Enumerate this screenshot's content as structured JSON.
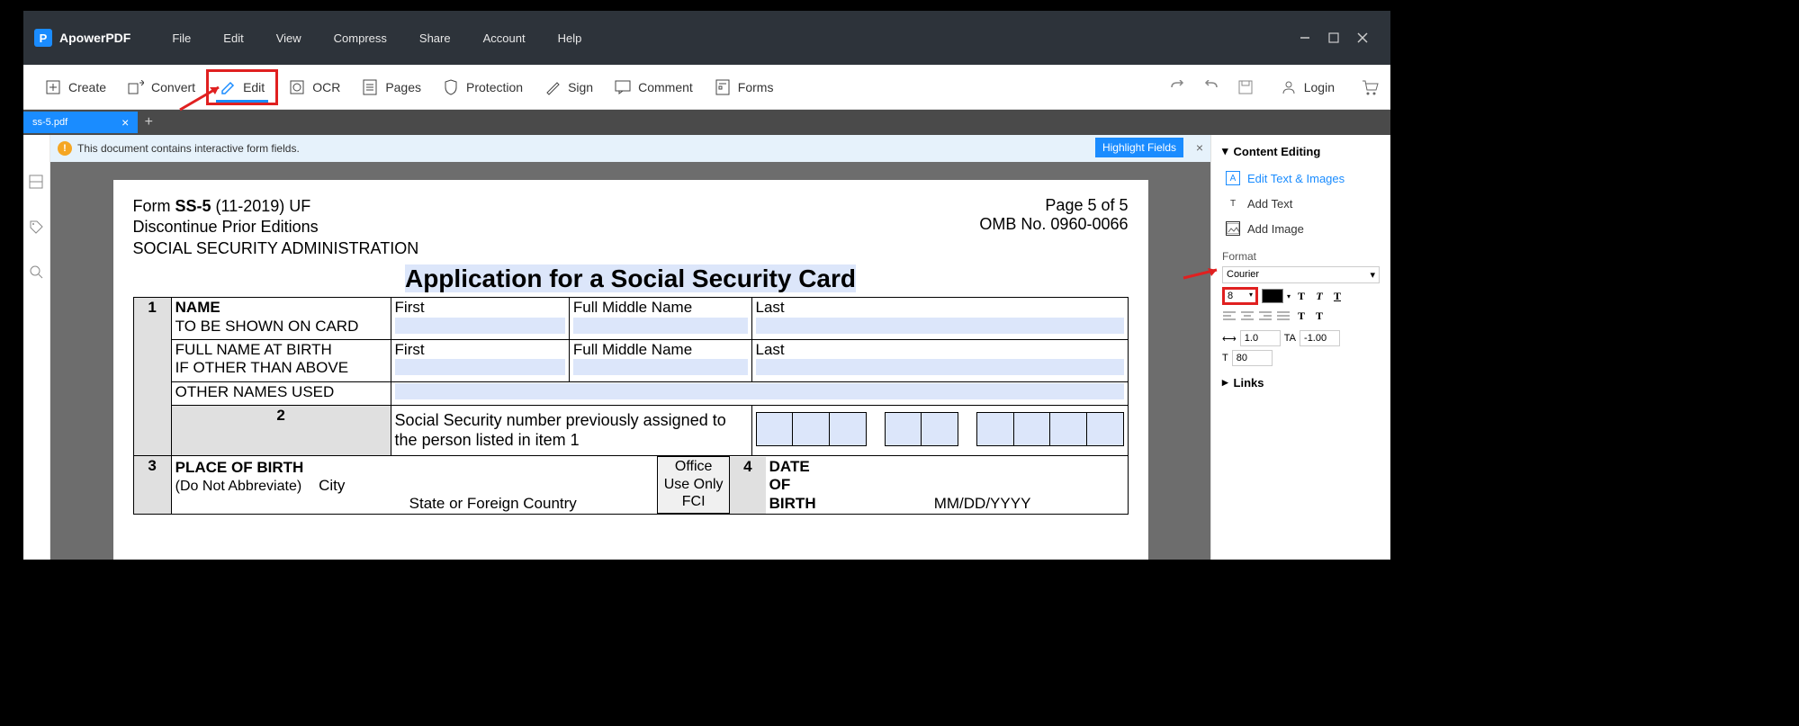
{
  "app": {
    "name": "ApowerPDF"
  },
  "menu": {
    "file": "File",
    "edit": "Edit",
    "view": "View",
    "compress": "Compress",
    "share": "Share",
    "account": "Account",
    "help": "Help"
  },
  "toolbar": {
    "create": "Create",
    "convert": "Convert",
    "edit": "Edit",
    "ocr": "OCR",
    "pages": "Pages",
    "protection": "Protection",
    "sign": "Sign",
    "comment": "Comment",
    "forms": "Forms",
    "login": "Login"
  },
  "tab": {
    "name": "ss-5.pdf"
  },
  "notice": {
    "text": "This document contains interactive form fields.",
    "highlight": "Highlight Fields"
  },
  "doc": {
    "form_id_pre": "Form ",
    "form_id_bold": "SS-5",
    "form_id_post": " (11-2019) UF",
    "discontinue": "Discontinue Prior Editions",
    "agency": "SOCIAL SECURITY ADMINISTRATION",
    "page_info": "Page 5 of 5",
    "omb": "OMB No. 0960-0066",
    "title": "Application for a Social Security Card",
    "name_label": "NAME",
    "name_sub": "TO BE SHOWN ON CARD",
    "full_name_label": "FULL NAME AT BIRTH",
    "if_other": "IF OTHER THAN ABOVE",
    "other_names": "OTHER NAMES USED",
    "first": "First",
    "middle": "Full Middle Name",
    "last": "Last",
    "ssn_text": "Social Security number previously assigned to the person listed in item 1",
    "pob_label": "PLACE OF BIRTH",
    "pob_sub": "(Do Not Abbreviate)",
    "city": "City",
    "state": "State or Foreign Country",
    "office": "Office Use Only",
    "fci": "FCI",
    "dob_label": "DATE OF BIRTH",
    "dob_fmt": "MM/DD/YYYY"
  },
  "panel": {
    "content_editing": "Content Editing",
    "edit_text": "Edit Text & Images",
    "add_text": "Add Text",
    "add_image": "Add Image",
    "format": "Format",
    "font": "Courier",
    "size": "8",
    "spacing1": "1.0",
    "spacing2": "-1.00",
    "spacing3": "80",
    "links": "Links"
  }
}
